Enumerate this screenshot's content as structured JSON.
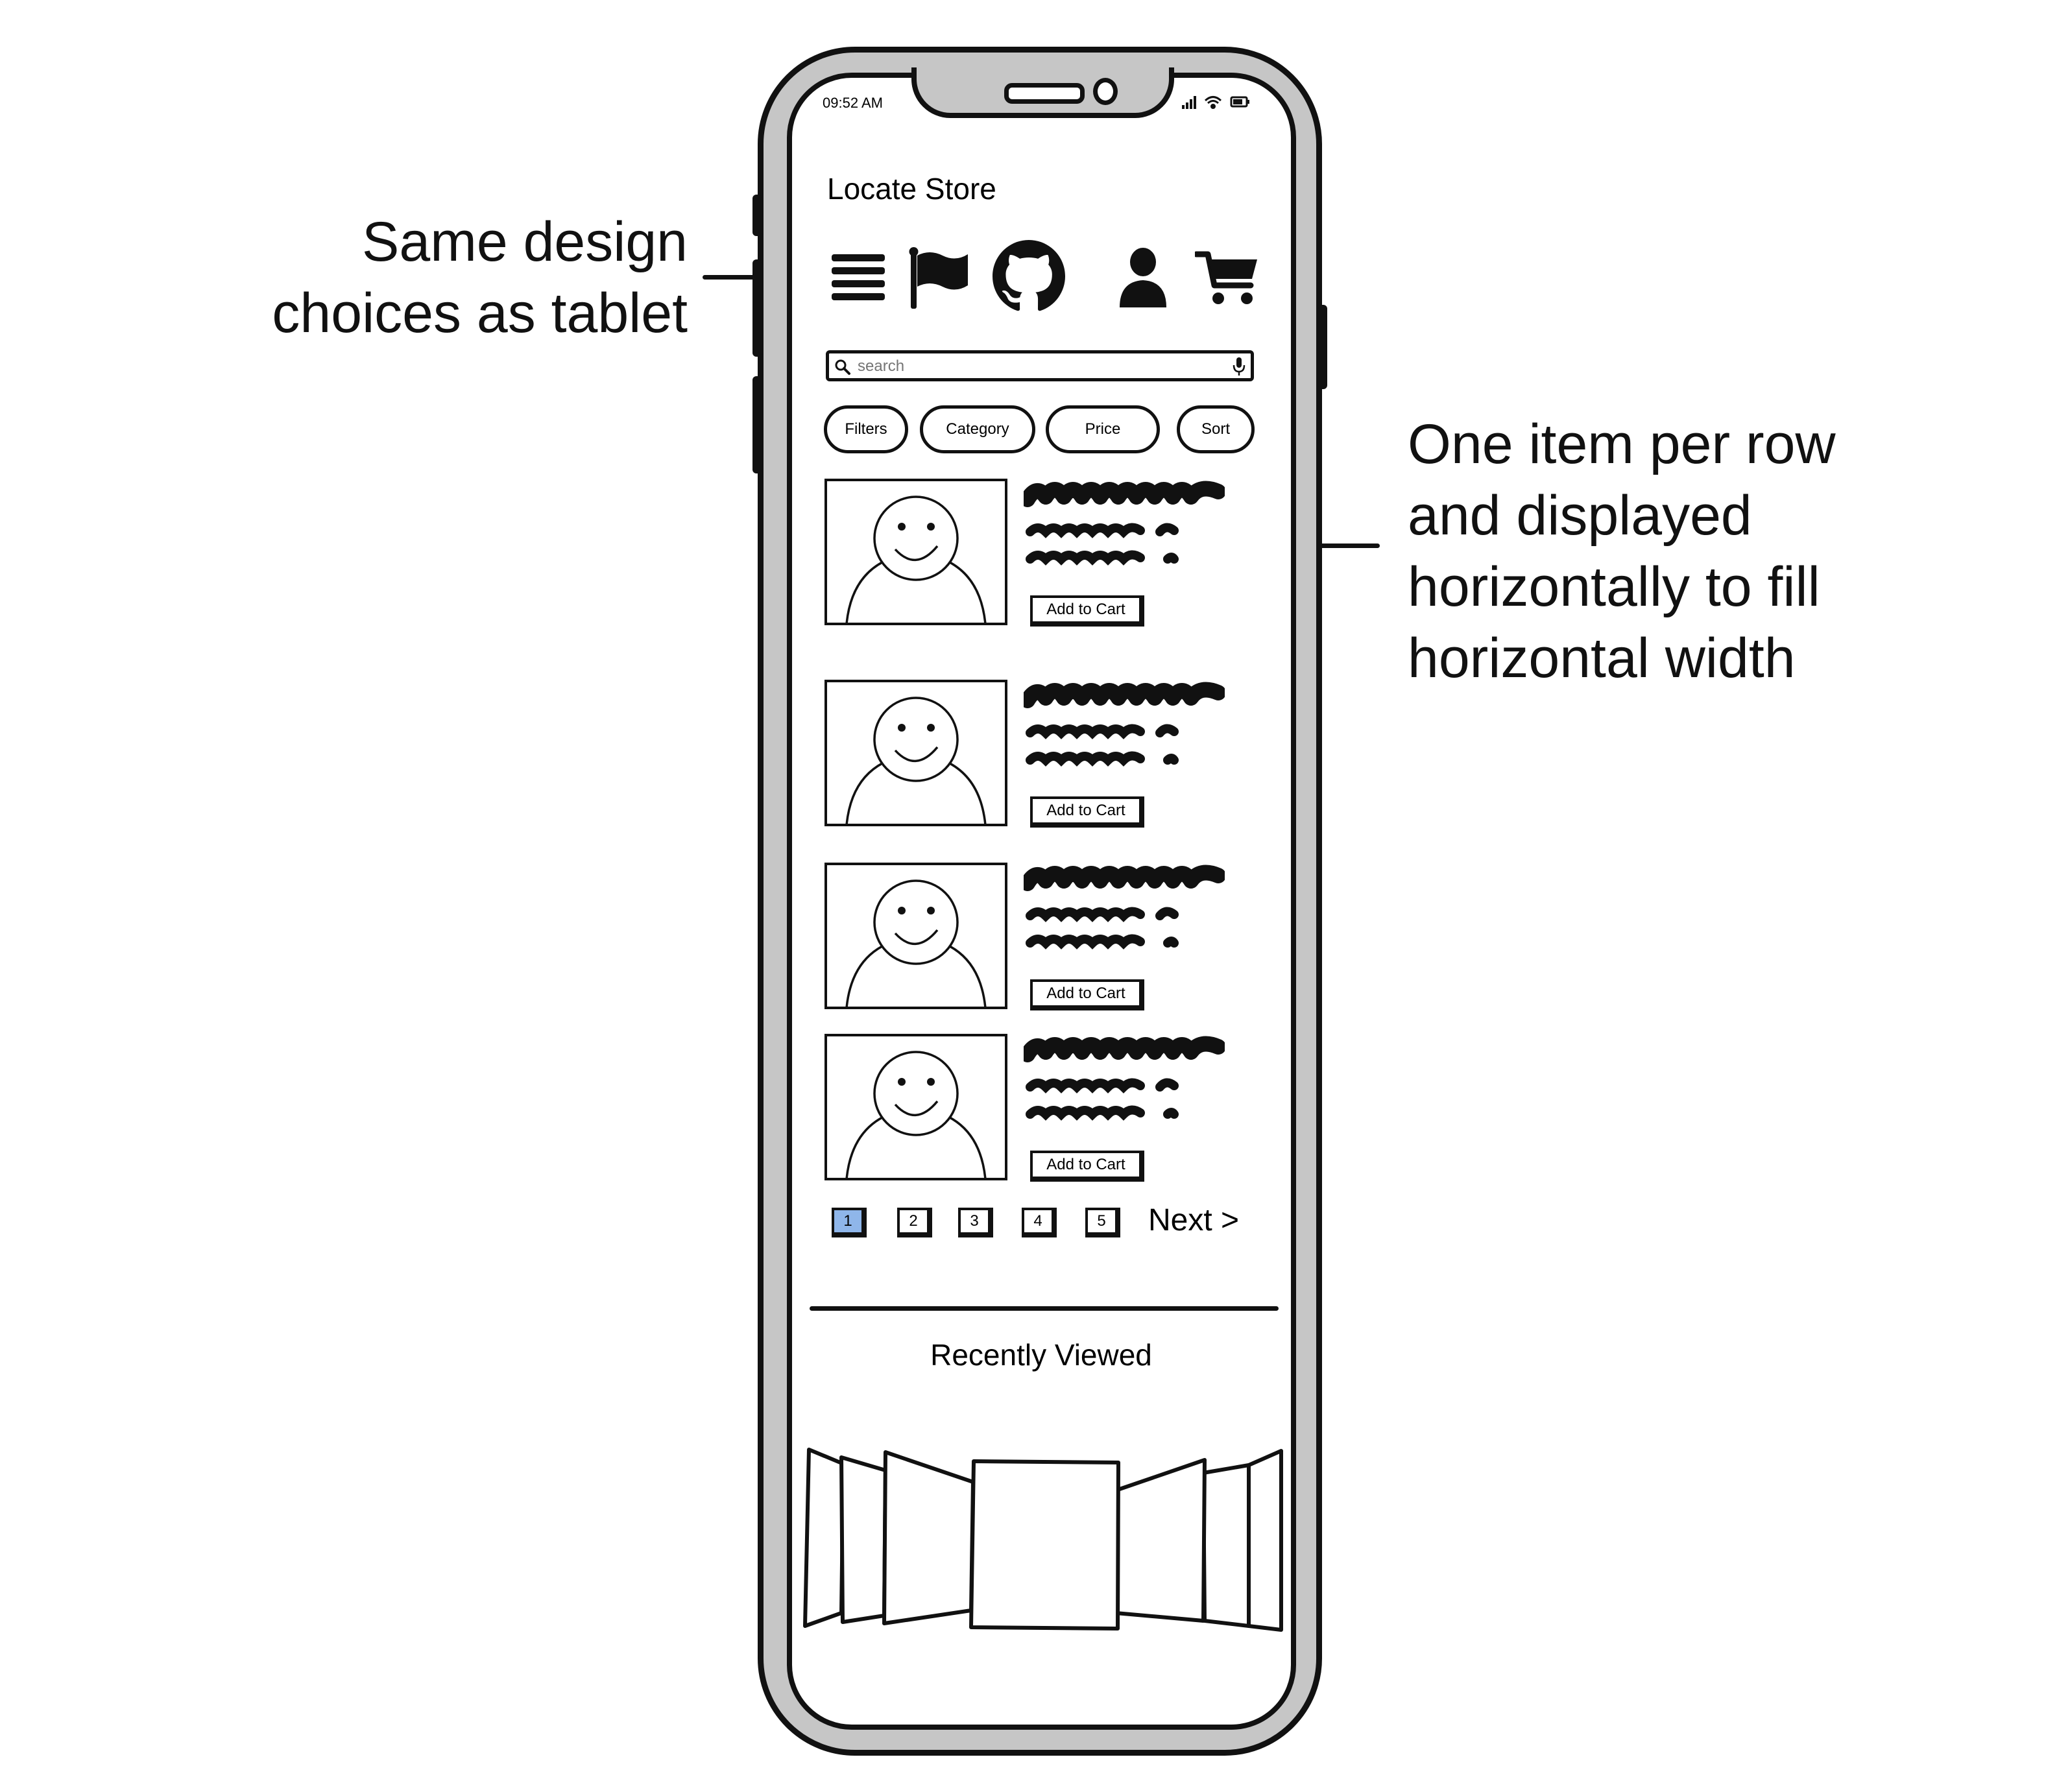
{
  "annotations": {
    "left_line1": "Same design",
    "left_line2": "choices as tablet",
    "right_line1": "One item per row",
    "right_line2": "and displayed",
    "right_line3": "horizontally to fill",
    "right_line4": "horizontal width"
  },
  "status_bar": {
    "time": "09:52 AM",
    "icons": [
      "signal-icon",
      "wifi-icon",
      "battery-icon"
    ]
  },
  "header": {
    "title": "Locate Store",
    "icons": [
      "hamburger-menu-icon",
      "flag-icon",
      "github-icon",
      "user-icon",
      "cart-icon"
    ]
  },
  "search": {
    "placeholder": "search",
    "value": ""
  },
  "filters": [
    {
      "label": "Filters"
    },
    {
      "label": "Category"
    },
    {
      "label": "Price"
    },
    {
      "label": "Sort"
    }
  ],
  "products": [
    {
      "button_label": "Add to Cart"
    },
    {
      "button_label": "Add to Cart"
    },
    {
      "button_label": "Add to Cart"
    },
    {
      "button_label": "Add to Cart"
    }
  ],
  "pagination": {
    "pages": [
      "1",
      "2",
      "3",
      "4",
      "5"
    ],
    "active": "1",
    "next_label": "Next >"
  },
  "recently_viewed": {
    "title": "Recently Viewed"
  },
  "colors": {
    "frame": "#c6c6c6",
    "outline": "#111111",
    "active_page": "#8fb6ea"
  }
}
